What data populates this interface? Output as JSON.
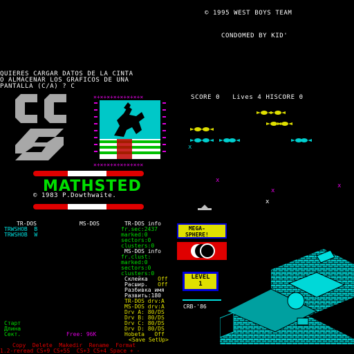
{
  "header": {
    "copyright": "© 1995 WEST BOYS TEAM",
    "condomed": "CONDOMED BY KID'"
  },
  "prompt": {
    "line1": "QUIERES CARGAR DATOS DE LA CINTA",
    "line2": "O ALMACENAR LOS GRAFICOS DE UNA",
    "line3": "PANTALLA (C/A) ? C"
  },
  "score_bar": {
    "score_label": "SCORE",
    "score": "0",
    "lives_label": "Lives",
    "lives": "4",
    "hiscore_label": "HISCORE",
    "hiscore": "0"
  },
  "title_art": {
    "mathsted": "MATHSTED",
    "credit": "© 1983 P.Dowthwaite."
  },
  "file_manager": {
    "col_trdos": "TR-DOS",
    "col_msdos": "MS-DOS",
    "col_info": "TR-DOS info",
    "files": [
      "TRWSHOB  B",
      "TRWSHOB  W"
    ],
    "info_lines": [
      "fr.sec:2437",
      "marked:0",
      "sectors:0",
      "clusters:0"
    ],
    "msdos_info_title": "MS-DOS info",
    "msdos_info_lines": [
      "fr.clust:",
      "marked:0",
      "sectors:0",
      "clusters:0"
    ],
    "settings": [
      {
        "label": "Склейка",
        "value": "Off"
      },
      {
        "label": "Расшир.",
        "value": "Off"
      },
      {
        "label": "Разбивка имя",
        "value": ""
      },
      {
        "label": "Развить:180",
        "value": ""
      }
    ],
    "drives": [
      "TR-DOS drv:A",
      "MS-DOS drv:A",
      "Drv A: 80/DS",
      "Drv B: 80/DS",
      "Drv C: 80/DS",
      "Drv D: 80/DS"
    ],
    "nobeta": "Нobeta   Off",
    "save_setup": "<Save SetUp>",
    "left_labels": [
      "Старт",
      "Длина",
      "Сект."
    ],
    "free_label": "Free: 96K",
    "menu": "Copy  Delete  Makedir  Rename  Format",
    "keys": "1.2-reread CS+9 CS+5S  CS+3 CS+4 Space + -"
  },
  "game_panel": {
    "mega_sphere": "MEGA-\nSPHERE!",
    "level_label": "LEVEL",
    "level": "1",
    "crb": "CRB-'86"
  },
  "colors": {
    "cyan": "#00e0e0",
    "green": "#00e000",
    "yellow": "#e0e000",
    "magenta": "#e000e0",
    "red": "#e00000",
    "blue": "#0000e0"
  }
}
